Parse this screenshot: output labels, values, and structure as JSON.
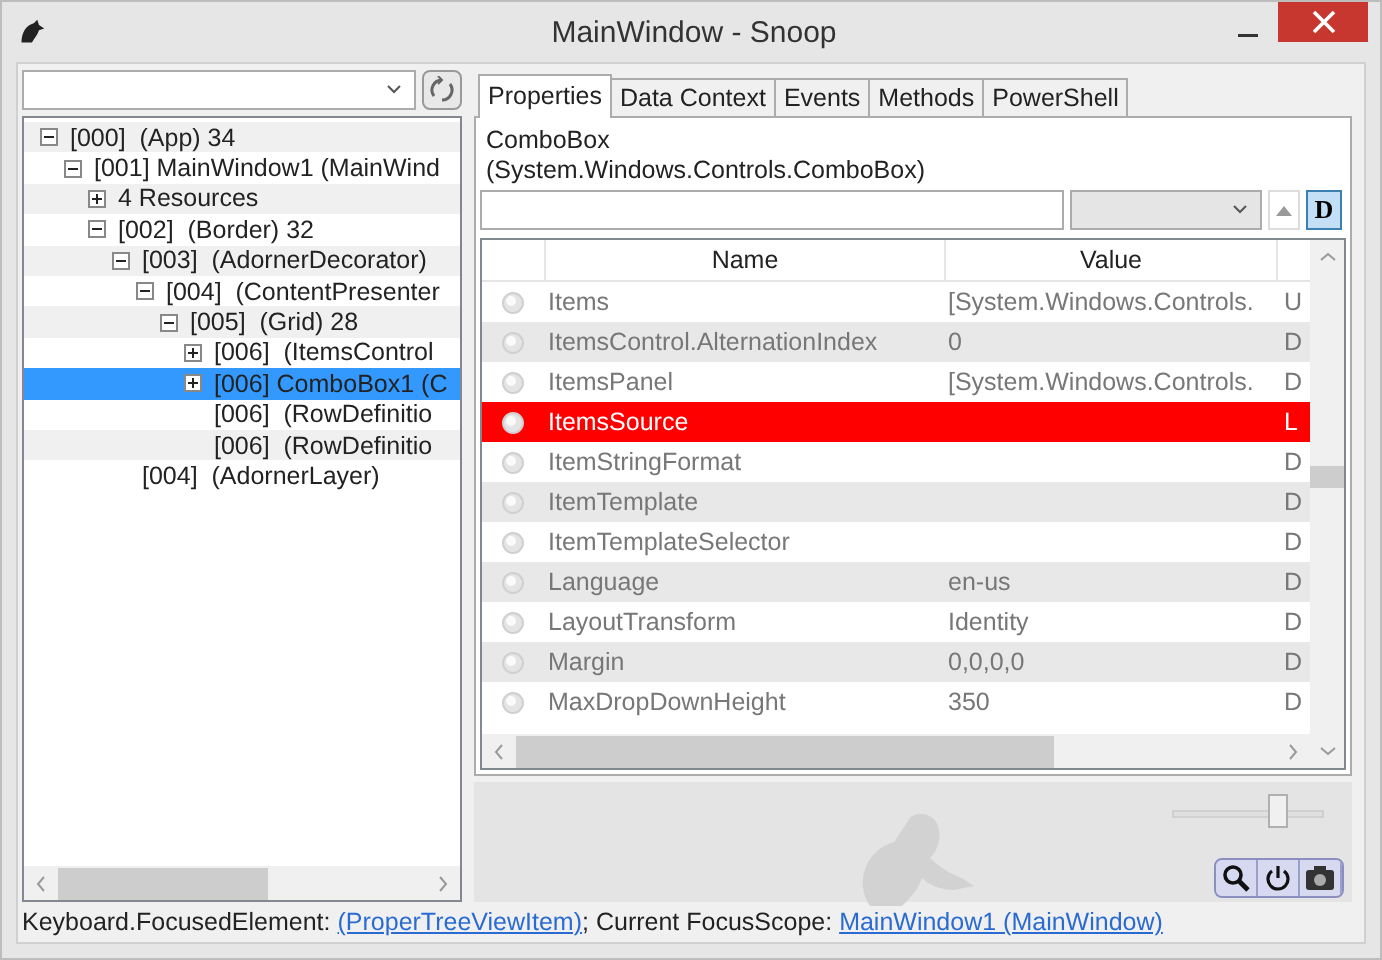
{
  "window": {
    "title": "MainWindow - Snoop"
  },
  "tree": [
    {
      "label": "[000]  (App) 34",
      "kind": "branch",
      "expanded": true,
      "selected": false,
      "children": [
        {
          "label": "[001] MainWindow1 (MainWind",
          "kind": "branch",
          "expanded": true,
          "selected": false,
          "children": [
            {
              "label": "4 Resources",
              "kind": "branch",
              "expanded": false,
              "selected": false
            },
            {
              "label": "[002]  (Border) 32",
              "kind": "branch",
              "expanded": true,
              "selected": false,
              "children": [
                {
                  "label": "[003]  (AdornerDecorator)",
                  "kind": "branch",
                  "expanded": true,
                  "selected": false,
                  "children": [
                    {
                      "label": "[004]  (ContentPresenter",
                      "kind": "branch",
                      "expanded": true,
                      "selected": false,
                      "children": [
                        {
                          "label": "[005]  (Grid) 28",
                          "kind": "branch",
                          "expanded": true,
                          "selected": false,
                          "children": [
                            {
                              "label": "[006]  (ItemsControl",
                              "kind": "branch",
                              "expanded": false,
                              "selected": false
                            },
                            {
                              "label": "[006] ComboBox1 (C",
                              "kind": "branch",
                              "expanded": false,
                              "selected": true
                            },
                            {
                              "label": "[006]  (RowDefinitio",
                              "kind": "leaf",
                              "selected": false
                            },
                            {
                              "label": "[006]  (RowDefinitio",
                              "kind": "leaf",
                              "selected": false
                            }
                          ]
                        }
                      ]
                    }
                  ]
                },
                {
                  "label": "[004]  (AdornerLayer)",
                  "kind": "leaf",
                  "selected": false
                }
              ]
            }
          ]
        }
      ]
    }
  ],
  "tabs": [
    {
      "label": "Properties",
      "selected": true
    },
    {
      "label": "Data Context",
      "selected": false
    },
    {
      "label": "Events",
      "selected": false
    },
    {
      "label": "Methods",
      "selected": false
    },
    {
      "label": "PowerShell",
      "selected": false
    }
  ],
  "target": {
    "name": "ComboBox",
    "type": "(System.Windows.Controls.ComboBox)"
  },
  "toolbar": {
    "default_toggle": "D",
    "default_on": true
  },
  "grid": {
    "columns": [
      "Name",
      "Value"
    ],
    "rows": [
      {
        "name": "Items",
        "value": "[System.Windows.Controls.",
        "column_3": "U",
        "highlighted": false
      },
      {
        "name": "ItemsControl.AlternationIndex",
        "value": "0",
        "column_3": "D",
        "highlighted": false
      },
      {
        "name": "ItemsPanel",
        "value": "[System.Windows.Controls.",
        "column_3": "D",
        "highlighted": false
      },
      {
        "name": "ItemsSource",
        "value": "",
        "column_3": "L",
        "highlighted": true
      },
      {
        "name": "ItemStringFormat",
        "value": "",
        "column_3": "D",
        "highlighted": false
      },
      {
        "name": "ItemTemplate",
        "value": "",
        "column_3": "D",
        "highlighted": false
      },
      {
        "name": "ItemTemplateSelector",
        "value": "",
        "column_3": "D",
        "highlighted": false
      },
      {
        "name": "Language",
        "value": "en-us",
        "column_3": "D",
        "highlighted": false
      },
      {
        "name": "LayoutTransform",
        "value": "Identity",
        "column_3": "D",
        "highlighted": false
      },
      {
        "name": "Margin",
        "value": "0,0,0,0",
        "column_3": "D",
        "highlighted": false
      },
      {
        "name": "MaxDropDownHeight",
        "value": "350",
        "column_3": "D",
        "highlighted": false
      }
    ]
  },
  "zoom": {
    "level": 0.75
  },
  "status_bar": {
    "focused_label": "Keyboard.FocusedElement:",
    "focused_link": "(ProperTreeViewItem)",
    "scope_label": "; Current FocusScope:",
    "scope_link": "MainWindow1 (MainWindow)"
  }
}
